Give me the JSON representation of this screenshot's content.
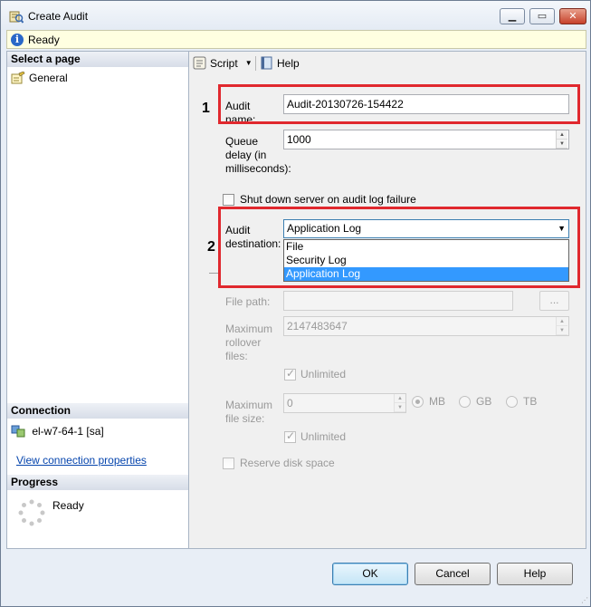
{
  "window": {
    "title": "Create Audit"
  },
  "status": {
    "text": "Ready"
  },
  "left": {
    "select_page_header": "Select a page",
    "pages": [
      {
        "label": "General"
      }
    ],
    "connection_header": "Connection",
    "connection_server": "el-w7-64-1 [sa]",
    "connection_link": "View connection properties",
    "progress_header": "Progress",
    "progress_status": "Ready"
  },
  "toolbar": {
    "script_label": "Script",
    "help_label": "Help"
  },
  "form": {
    "audit_name_label": "Audit name:",
    "audit_name_value": "Audit-20130726-154422",
    "queue_delay_label": "Queue delay (in milliseconds):",
    "queue_delay_value": "1000",
    "shutdown_label": "Shut down server on audit log failure",
    "destination_label": "Audit destination:",
    "destination_value": "Application Log",
    "destination_options": [
      "File",
      "Security Log",
      "Application Log"
    ],
    "file_path_label": "File path:",
    "file_path_value": "",
    "browse_label": "...",
    "max_rollover_label": "Maximum rollover files:",
    "max_rollover_value": "2147483647",
    "unlimited_label": "Unlimited",
    "max_file_size_label": "Maximum file size:",
    "max_file_size_value": "0",
    "units": [
      "MB",
      "GB",
      "TB"
    ],
    "reserve_label": "Reserve disk space"
  },
  "annotations": {
    "one": "1",
    "two": "2"
  },
  "buttons": {
    "ok": "OK",
    "cancel": "Cancel",
    "help": "Help"
  }
}
